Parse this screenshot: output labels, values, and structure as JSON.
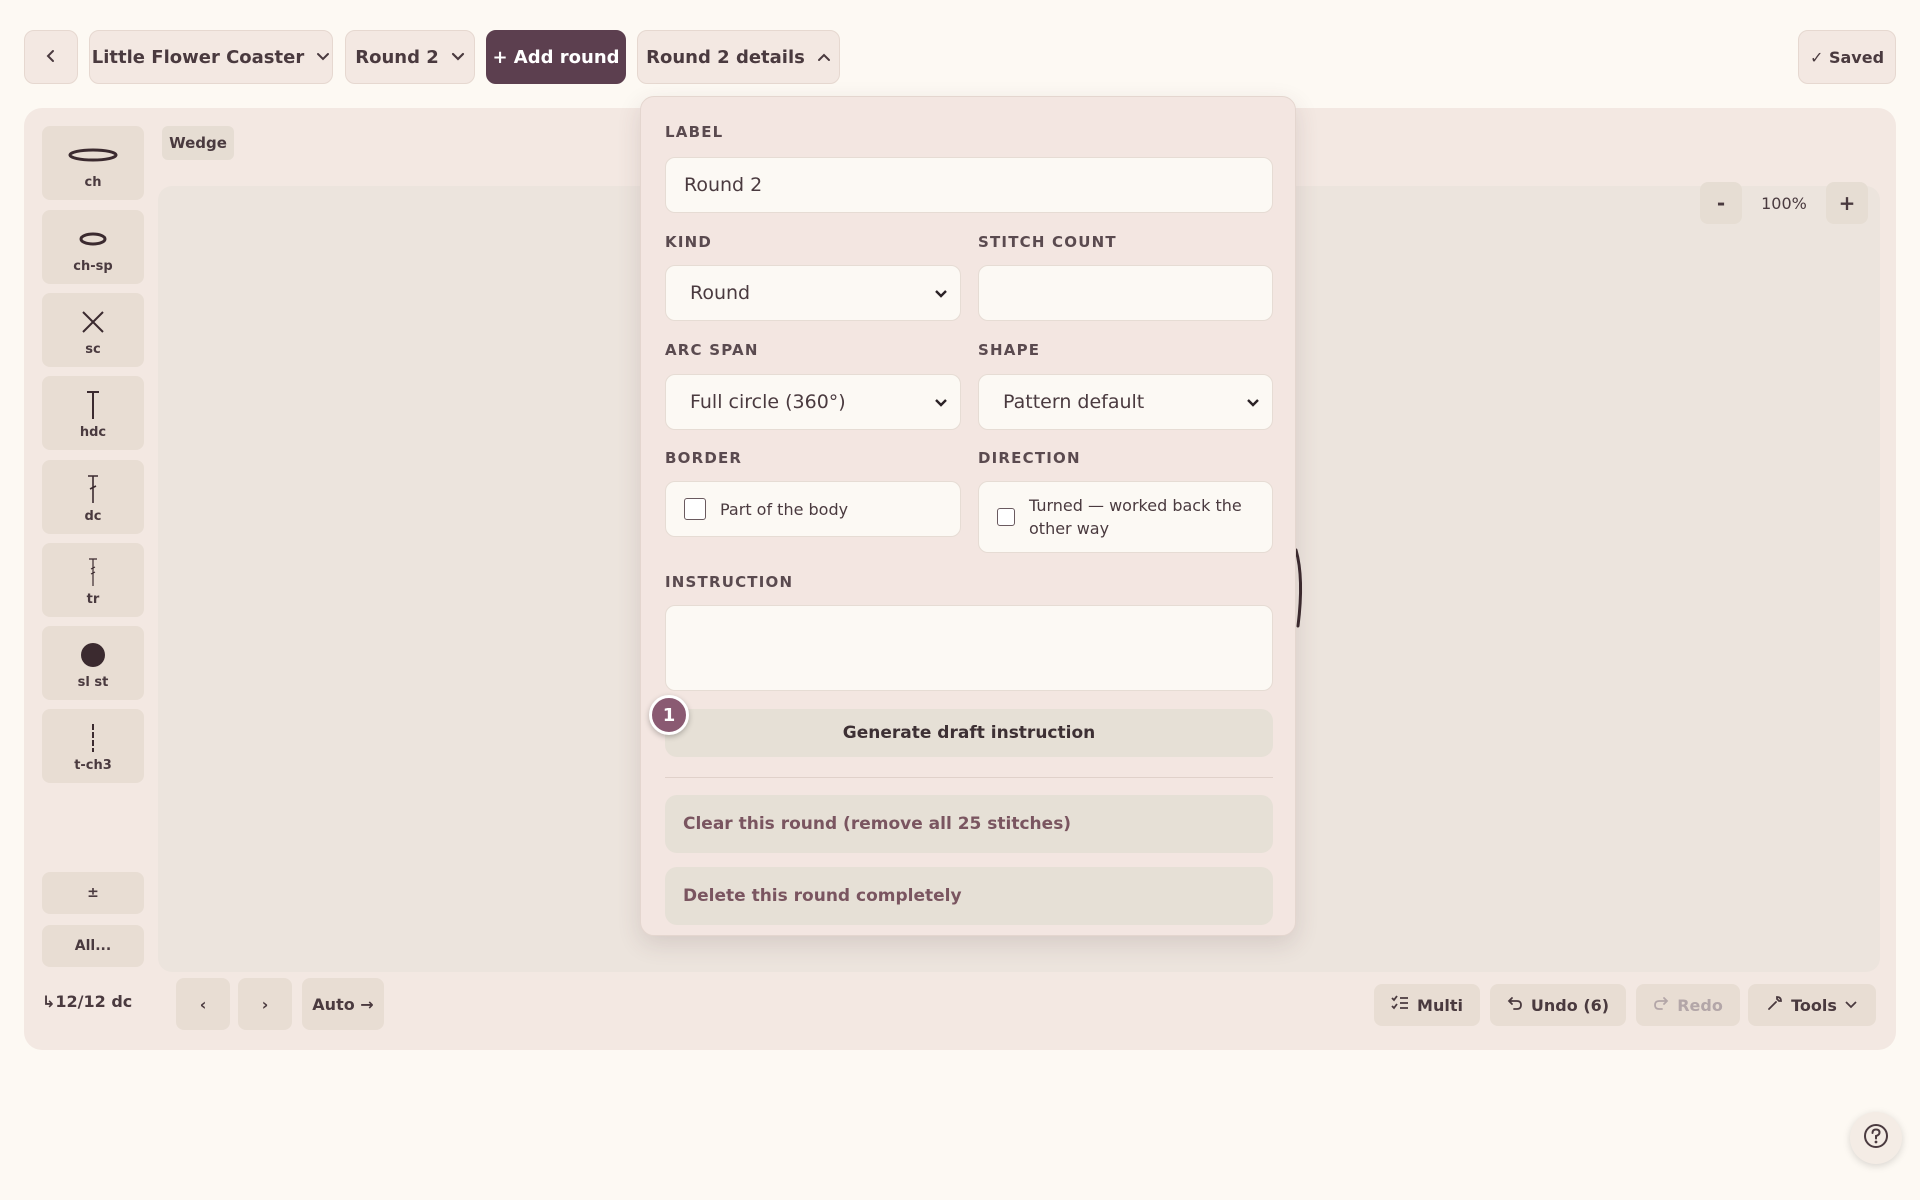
{
  "topbar": {
    "pattern_name": "Little Flower Coaster",
    "round_selected": "Round 2",
    "add_round_label": "+ Add round",
    "details_label": "Round 2 details",
    "saved_label": "✓ Saved"
  },
  "canvas": {
    "wedge_label": "Wedge",
    "zoom_level": "100%",
    "zoom_out": "-",
    "zoom_in": "+"
  },
  "stitch_palette": [
    {
      "label": "ch",
      "icon": "chain-oval-icon"
    },
    {
      "label": "ch-sp",
      "icon": "chain-space-icon"
    },
    {
      "label": "sc",
      "icon": "x-cross-icon"
    },
    {
      "label": "hdc",
      "icon": "t-bar-icon"
    },
    {
      "label": "dc",
      "icon": "t-one-cross-icon"
    },
    {
      "label": "tr",
      "icon": "t-two-cross-icon"
    },
    {
      "label": "sl st",
      "icon": "filled-dot-icon"
    },
    {
      "label": "t-ch3",
      "icon": "turning-chain-icon"
    }
  ],
  "palette_extra": {
    "plusminus": "±",
    "all": "All..."
  },
  "bottombar": {
    "stitch_status": "↳12/12 dc",
    "prev": "‹",
    "next": "›",
    "auto": "Auto →",
    "multi": "Multi",
    "undo": "Undo (6)",
    "redo": "Redo",
    "tools": "Tools"
  },
  "details_panel": {
    "label_heading": "LABEL",
    "label_value": "Round 2",
    "kind_heading": "KIND",
    "kind_value": "Round",
    "stitch_count_heading": "STITCH COUNT",
    "stitch_count_value": "",
    "arc_span_heading": "ARC SPAN",
    "arc_span_value": "Full circle (360°)",
    "shape_heading": "SHAPE",
    "shape_value": "Pattern default",
    "border_heading": "BORDER",
    "border_checkbox_label": "Part of the body",
    "direction_heading": "DIRECTION",
    "direction_checkbox_label": "Turned — worked back the other way",
    "instruction_heading": "INSTRUCTION",
    "instruction_value": "",
    "generate_label": "Generate draft instruction",
    "clear_label": "Clear this round (remove all 25 stitches)",
    "delete_label": "Delete this round completely",
    "step_badge": "1"
  },
  "colors": {
    "accent": "#5c3f4f",
    "background": "#fdf9f3",
    "panel": "#f3e6e1",
    "badge": "#8a5a72"
  }
}
